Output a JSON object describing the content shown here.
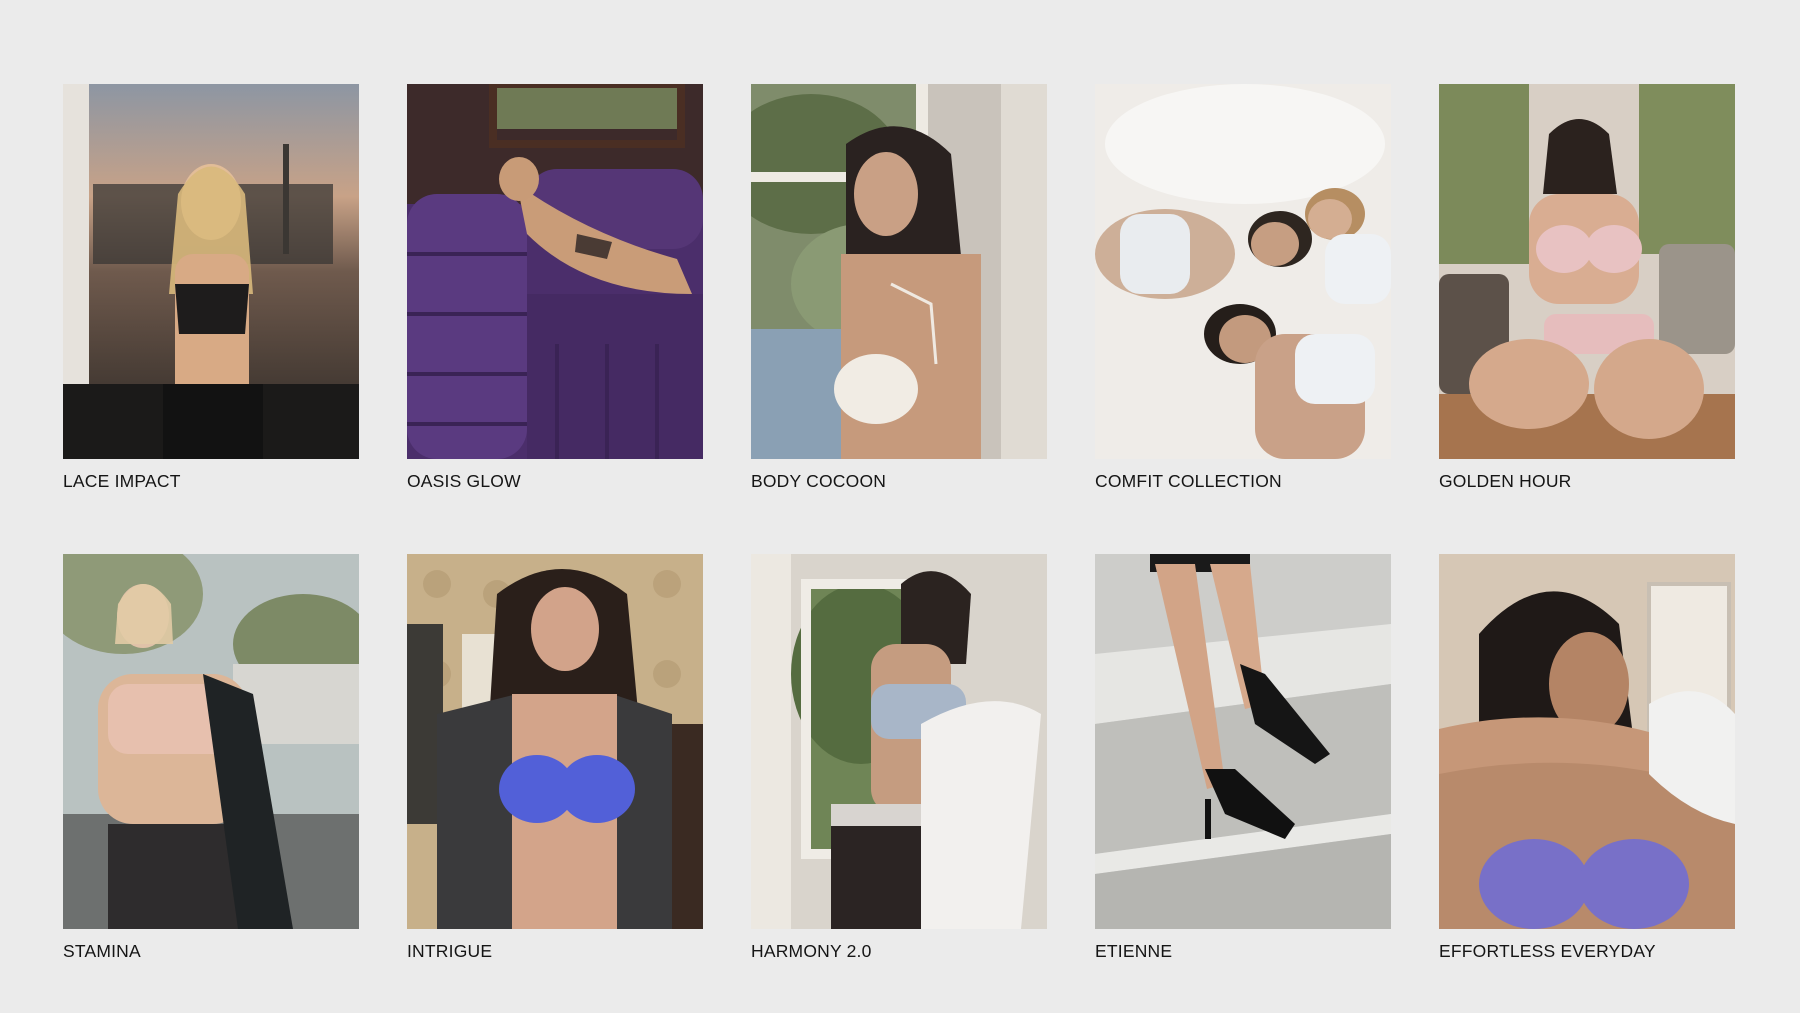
{
  "gallery": {
    "items": [
      {
        "label": "LACE IMPACT",
        "name": "lace-impact"
      },
      {
        "label": "OASIS GLOW",
        "name": "oasis-glow"
      },
      {
        "label": "BODY COCOON",
        "name": "body-cocoon"
      },
      {
        "label": "COMFIT COLLECTION",
        "name": "comfit-collection"
      },
      {
        "label": "GOLDEN HOUR",
        "name": "golden-hour"
      },
      {
        "label": "STAMINA",
        "name": "stamina"
      },
      {
        "label": "INTRIGUE",
        "name": "intrigue"
      },
      {
        "label": "HARMONY 2.0",
        "name": "harmony-2-0"
      },
      {
        "label": "ETIENNE",
        "name": "etienne"
      },
      {
        "label": "EFFORTLESS EVERYDAY",
        "name": "effortless-everyday"
      }
    ]
  },
  "colors": {
    "page_background": "#ebebeb",
    "label_text": "#151515"
  }
}
